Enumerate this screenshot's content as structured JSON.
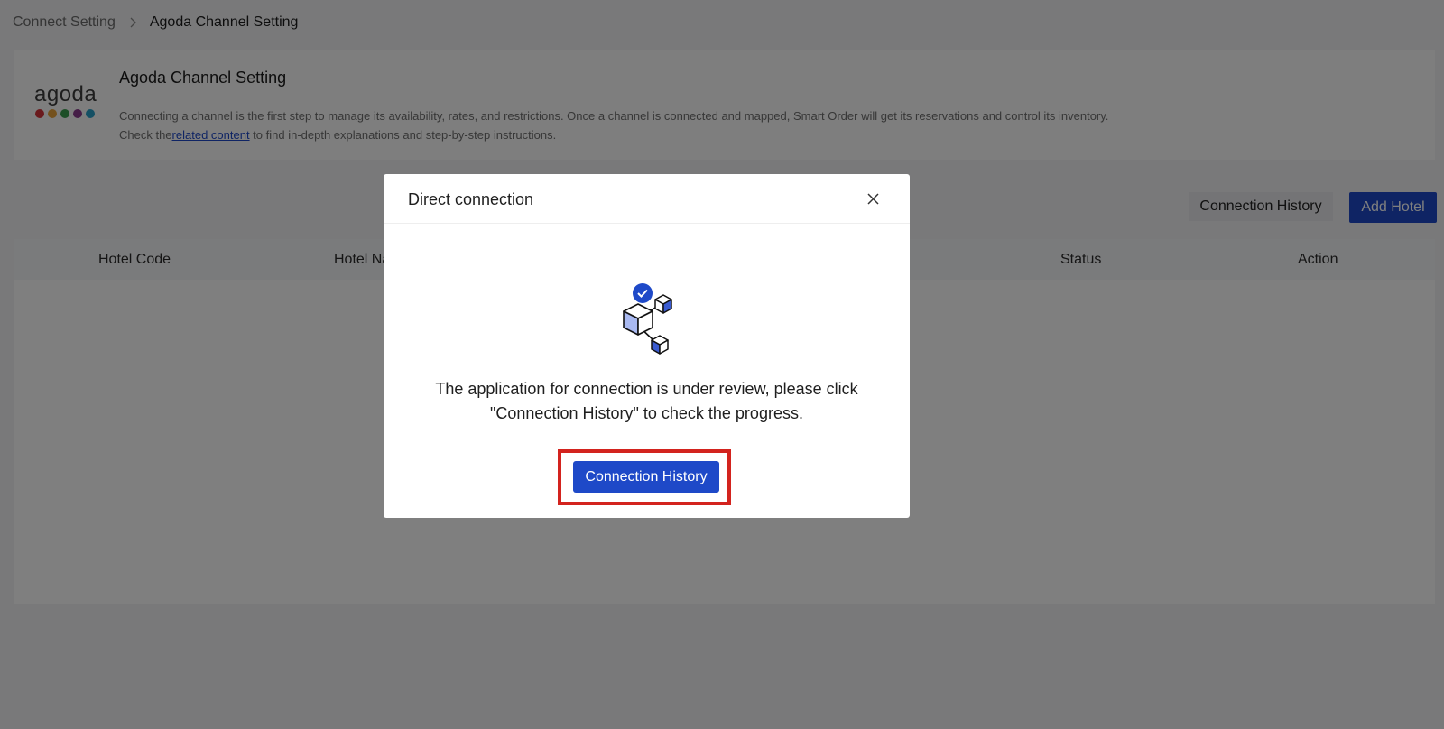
{
  "breadcrumb": {
    "parent": "Connect Setting",
    "current": "Agoda Channel Setting"
  },
  "channel_card": {
    "logo_text": "agoda",
    "logo_dot_colors": [
      "#d4343a",
      "#e8a33a",
      "#3a9d4f",
      "#8a3c8e",
      "#2aa0c8"
    ],
    "title": "Agoda Channel Setting",
    "description_line1": "Connecting a channel is the first step to manage its availability, rates, and restrictions. Once a channel is connected and mapped, Smart Order will get its reservations and control its inventory.",
    "description_line2_prefix": "Check the",
    "description_link": "related content",
    "description_line2_suffix": " to find in-depth explanations and step-by-step instructions."
  },
  "toolbar": {
    "connection_history_label": "Connection History",
    "add_hotel_label": "Add Hotel"
  },
  "table": {
    "columns": [
      "Hotel Code",
      "Hotel Na",
      "Status",
      "Action"
    ]
  },
  "modal": {
    "title": "Direct connection",
    "message_line1": "The application for connection is under review, please click",
    "message_line2": "\"Connection History\" to check the progress.",
    "button_label": "Connection History"
  },
  "colors": {
    "primary": "#1e49c8",
    "highlight": "#d3231e"
  }
}
